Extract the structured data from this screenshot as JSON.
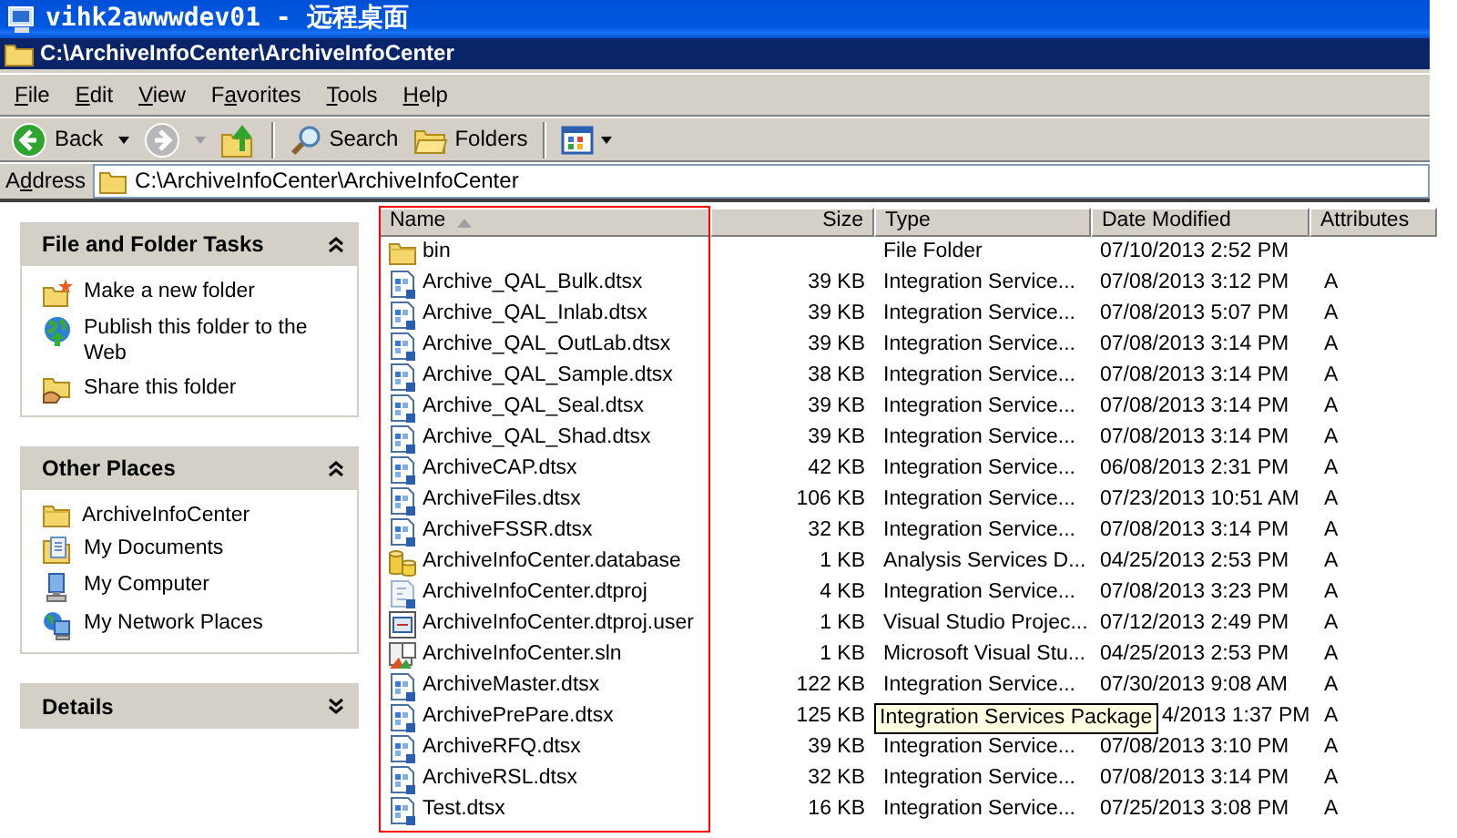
{
  "rdp_title": "vihk2awwwdev01 - 远程桌面",
  "window": {
    "title": "C:\\ArchiveInfoCenter\\ArchiveInfoCenter"
  },
  "menu": [
    {
      "accel": "F",
      "after": "ile"
    },
    {
      "accel": "E",
      "after": "dit"
    },
    {
      "accel": "V",
      "after": "iew"
    },
    {
      "before": "F",
      "accel": "a",
      "after": "vorites"
    },
    {
      "accel": "T",
      "after": "ools"
    },
    {
      "accel": "H",
      "after": "elp"
    }
  ],
  "toolbar": [
    {
      "kind": "back",
      "label": "Back",
      "disabled": false
    },
    {
      "kind": "forward",
      "disabled": true
    },
    {
      "kind": "up"
    },
    {
      "kind": "separator"
    },
    {
      "kind": "search",
      "label": "Search"
    },
    {
      "kind": "folders",
      "label": "Folders"
    },
    {
      "kind": "separator"
    },
    {
      "kind": "views"
    }
  ],
  "address": {
    "label_parts": [
      "A",
      "d",
      "dress"
    ],
    "value": "C:\\ArchiveInfoCenter\\ArchiveInfoCenter"
  },
  "sidebar": [
    {
      "title": "File and Folder Tasks",
      "expanded": true,
      "items": [
        {
          "kind": "new-folder",
          "label": "Make a new folder"
        },
        {
          "kind": "globe",
          "label": "Publish this folder to the Web"
        },
        {
          "kind": "share",
          "label": "Share this folder"
        }
      ]
    },
    {
      "title": "Other Places",
      "expanded": true,
      "items": [
        {
          "kind": "folder",
          "label": "ArchiveInfoCenter"
        },
        {
          "kind": "documents",
          "label": "My Documents"
        },
        {
          "kind": "computer",
          "label": "My Computer"
        },
        {
          "kind": "network",
          "label": "My Network Places"
        }
      ]
    },
    {
      "title": "Details",
      "expanded": false
    }
  ],
  "table": {
    "columns": [
      {
        "label": "Name",
        "sorted": true
      },
      {
        "label": "Size",
        "sorted": false
      },
      {
        "label": "Type",
        "sorted": false
      },
      {
        "label": "Date Modified",
        "sorted": false
      },
      {
        "label": "Attributes",
        "sorted": false
      }
    ],
    "name_column_framed": true,
    "rows": [
      {
        "kind": "folder",
        "name": "bin",
        "type": "File Folder",
        "date": "07/10/2013 2:52 PM"
      },
      {
        "kind": "dtsx",
        "name": "Archive_QAL_Bulk.dtsx",
        "size": "39 KB",
        "type": "Integration Service...",
        "date": "07/08/2013 3:12 PM",
        "attributes": "A"
      },
      {
        "kind": "dtsx",
        "name": "Archive_QAL_Inlab.dtsx",
        "size": "39 KB",
        "type": "Integration Service...",
        "date": "07/08/2013 5:07 PM",
        "attributes": "A"
      },
      {
        "kind": "dtsx",
        "name": "Archive_QAL_OutLab.dtsx",
        "size": "39 KB",
        "type": "Integration Service...",
        "date": "07/08/2013 3:14 PM",
        "attributes": "A"
      },
      {
        "kind": "dtsx",
        "name": "Archive_QAL_Sample.dtsx",
        "size": "38 KB",
        "type": "Integration Service...",
        "date": "07/08/2013 3:14 PM",
        "attributes": "A"
      },
      {
        "kind": "dtsx",
        "name": "Archive_QAL_Seal.dtsx",
        "size": "39 KB",
        "type": "Integration Service...",
        "date": "07/08/2013 3:14 PM",
        "attributes": "A"
      },
      {
        "kind": "dtsx",
        "name": "Archive_QAL_Shad.dtsx",
        "size": "39 KB",
        "type": "Integration Service...",
        "date": "07/08/2013 3:14 PM",
        "attributes": "A"
      },
      {
        "kind": "dtsx",
        "name": "ArchiveCAP.dtsx",
        "size": "42 KB",
        "type": "Integration Service...",
        "date": "06/08/2013 2:31 PM",
        "attributes": "A"
      },
      {
        "kind": "dtsx",
        "name": "ArchiveFiles.dtsx",
        "size": "106 KB",
        "type": "Integration Service...",
        "date": "07/23/2013 10:51 AM",
        "attributes": "A"
      },
      {
        "kind": "dtsx",
        "name": "ArchiveFSSR.dtsx",
        "size": "32 KB",
        "type": "Integration Service...",
        "date": "07/08/2013 3:14 PM",
        "attributes": "A"
      },
      {
        "kind": "database",
        "name": "ArchiveInfoCenter.database",
        "size": "1 KB",
        "type": "Analysis Services D...",
        "date": "04/25/2013 2:53 PM",
        "attributes": "A"
      },
      {
        "kind": "dtproj",
        "name": "ArchiveInfoCenter.dtproj",
        "size": "4 KB",
        "type": "Integration Service...",
        "date": "07/08/2013 3:23 PM",
        "attributes": "A"
      },
      {
        "kind": "user",
        "name": "ArchiveInfoCenter.dtproj.user",
        "size": "1 KB",
        "type": "Visual Studio Projec...",
        "date": "07/12/2013 2:49 PM",
        "attributes": "A"
      },
      {
        "kind": "sln",
        "name": "ArchiveInfoCenter.sln",
        "size": "1 KB",
        "type": "Microsoft Visual Stu...",
        "date": "04/25/2013 2:53 PM",
        "attributes": "A"
      },
      {
        "kind": "dtsx",
        "name": "ArchiveMaster.dtsx",
        "size": "122 KB",
        "type": "Integration Service...",
        "date": "07/30/2013 9:08 AM",
        "attributes": "A"
      },
      {
        "kind": "dtsx",
        "name": "ArchivePrePare.dtsx",
        "size": "125 KB",
        "tooltip": "Integration Services Package",
        "date": "4/2013 1:37 PM",
        "attributes": "A"
      },
      {
        "kind": "dtsx",
        "name": "ArchiveRFQ.dtsx",
        "size": "39 KB",
        "type": "Integration Service...",
        "date": "07/08/2013 3:10 PM",
        "attributes": "A"
      },
      {
        "kind": "dtsx",
        "name": "ArchiveRSL.dtsx",
        "size": "32 KB",
        "type": "Integration Service...",
        "date": "07/08/2013 3:14 PM",
        "attributes": "A"
      },
      {
        "kind": "dtsx",
        "name": "Test.dtsx",
        "size": "16 KB",
        "type": "Integration Service...",
        "date": "07/25/2013 3:08 PM",
        "attributes": "A"
      }
    ]
  }
}
